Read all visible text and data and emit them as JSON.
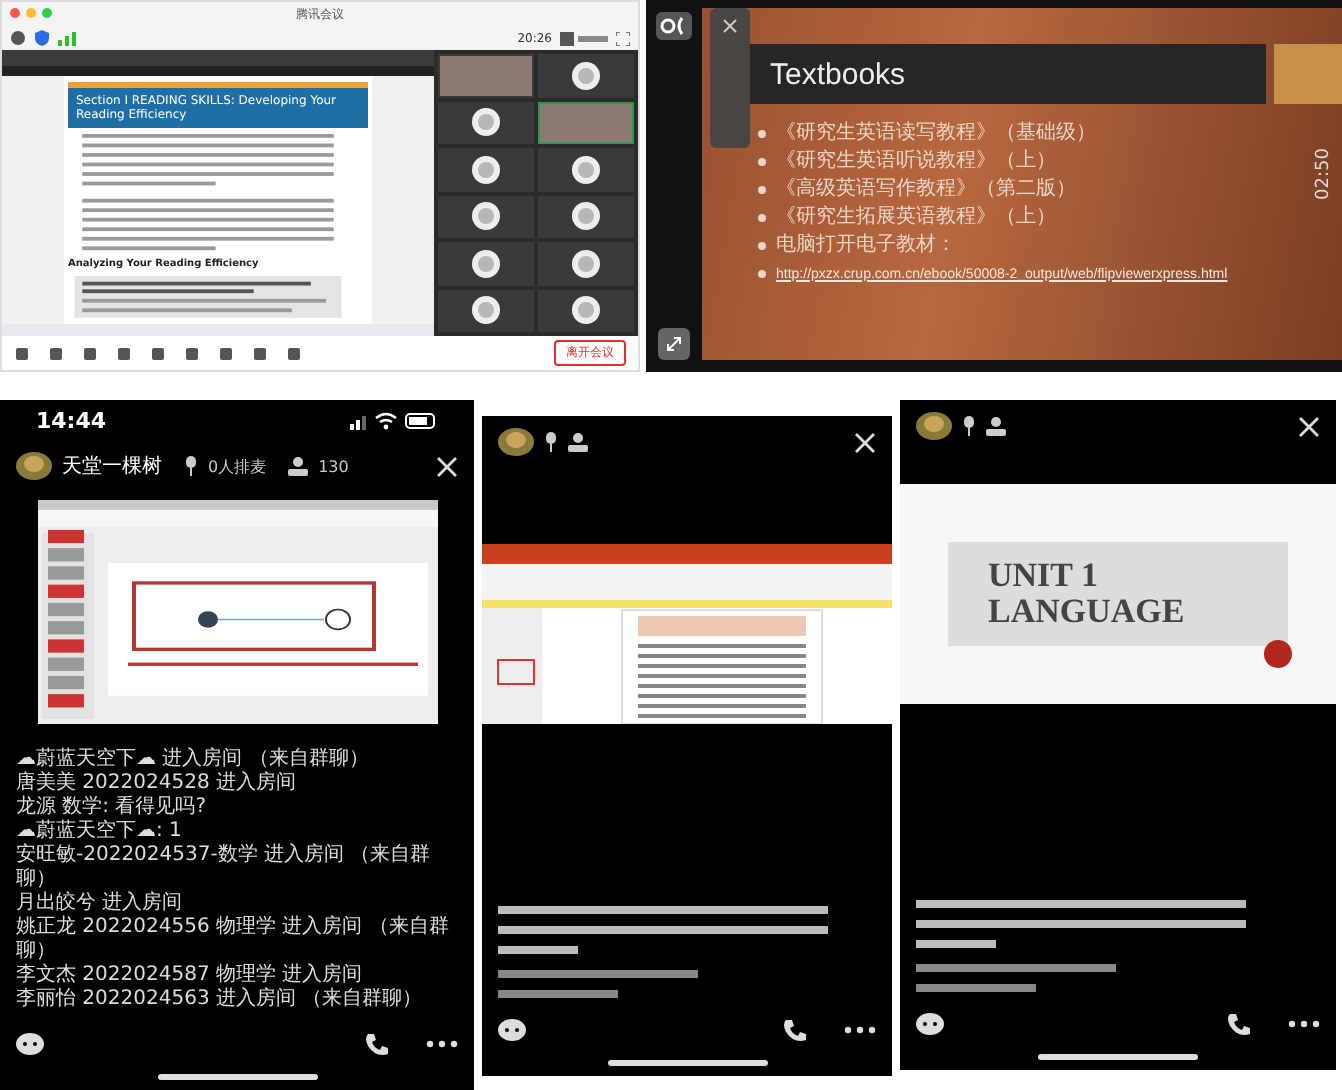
{
  "meeting": {
    "title": "腾讯会议",
    "time": "20:26",
    "document": {
      "heading": "Section Ⅰ READING SKILLS: Developing Your Reading Efficiency",
      "subheading": "Analyzing Your Reading Efficiency"
    },
    "participants": [
      {
        "kind": "video",
        "selected": false
      },
      {
        "kind": "avatar",
        "selected": false
      },
      {
        "kind": "avatar",
        "selected": false
      },
      {
        "kind": "video",
        "selected": true
      },
      {
        "kind": "avatar",
        "selected": false
      },
      {
        "kind": "avatar",
        "selected": false
      },
      {
        "kind": "avatar",
        "selected": false
      },
      {
        "kind": "avatar",
        "selected": false
      },
      {
        "kind": "avatar",
        "selected": false
      },
      {
        "kind": "avatar",
        "selected": false
      },
      {
        "kind": "avatar",
        "selected": false
      },
      {
        "kind": "avatar",
        "selected": false
      }
    ],
    "leave_button": "离开会议"
  },
  "slide": {
    "title": "Textbooks",
    "items": [
      "《研究生英语读写教程》（基础级）",
      "《研究生英语听说教程》（上）",
      "《高级英语写作教程》（第二版）",
      "《研究生拓展英语教程》（上）",
      "电脑打开电子教材："
    ],
    "link": "http://pxzx.crup.com.cn/ebook/50008-2_output/web/flipviewerxpress.html",
    "timer": "02:50"
  },
  "phones": [
    {
      "kind": "presentation",
      "time": "14:44",
      "host": "天堂一棵树",
      "queue": "0人排麦",
      "viewers": "130",
      "messages": [
        "☁蔚蓝天空下☁ 进入房间 （来自群聊）",
        "唐美美 2022024528 进入房间",
        "龙源 数学: 看得见吗?",
        "☁蔚蓝天空下☁: 1",
        "安旺敏-2022024537-数学 进入房间 （来自群聊）",
        "月出皎兮 进入房间",
        "姚正龙 2022024556 物理学 进入房间 （来自群聊）",
        "李文杰 2022024587 物理学 进入房间",
        "李丽怡 2022024563 进入房间 （来自群聊）"
      ]
    },
    {
      "kind": "document"
    },
    {
      "kind": "title_slide",
      "slide_title": [
        "UNIT 1",
        "LANGUAGE"
      ]
    }
  ]
}
